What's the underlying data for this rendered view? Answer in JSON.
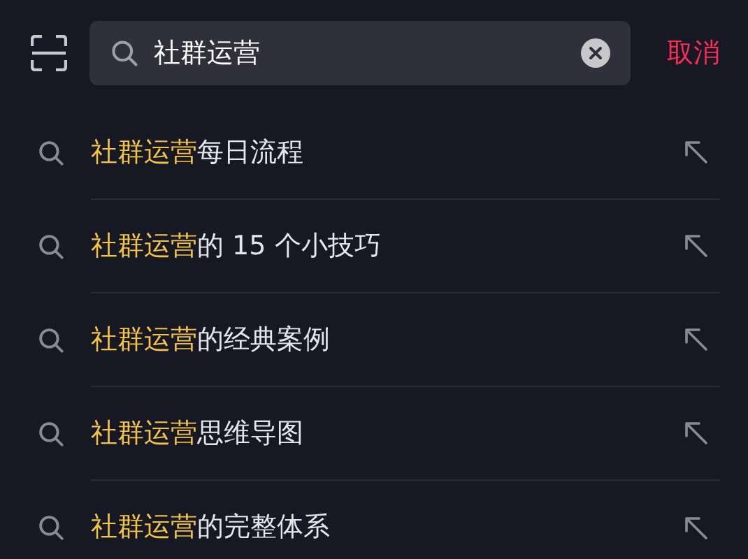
{
  "search": {
    "value": "社群运营",
    "cancel": "取消"
  },
  "suggestions": [
    {
      "highlight": "社群运营",
      "rest": "每日流程"
    },
    {
      "highlight": "社群运营",
      "rest": "的 15 个小技巧"
    },
    {
      "highlight": "社群运营",
      "rest": "的经典案例"
    },
    {
      "highlight": "社群运营",
      "rest": "思维导图"
    },
    {
      "highlight": "社群运营",
      "rest": "的完整体系"
    }
  ]
}
